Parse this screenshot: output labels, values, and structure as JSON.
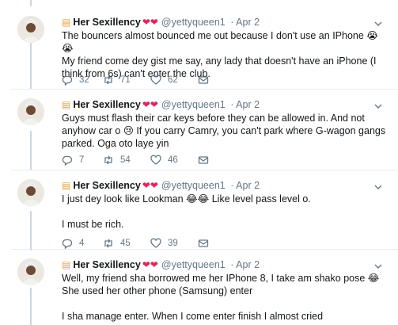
{
  "tweets": [
    {
      "author": "Her Sexillency",
      "handle": "@yettyqueen1",
      "date": "· Apr 2",
      "lines": [
        "The bouncers almost bounced me out because I don't use an IPhone 😭😭",
        "My friend come dey gist me say, any lady that doesn't have an iPhone (I think from 6s) can't enter the club."
      ],
      "replies": "32",
      "retweets": "71",
      "likes": "62"
    },
    {
      "author": "Her Sexillency",
      "handle": "@yettyqueen1",
      "date": "· Apr 2",
      "lines": [
        "Guys must flash their car keys before they can be allowed in. And not anyhow car o 😢 If you carry Camry,  you can't park where G-wagon gangs parked. Oga oto laye yin"
      ],
      "replies": "7",
      "retweets": "54",
      "likes": "46"
    },
    {
      "author": "Her Sexillency",
      "handle": "@yettyqueen1",
      "date": "· Apr 2",
      "lines": [
        "I just dey look like Lookman 😂😂 Like level pass level o.",
        "",
        "I must be rich."
      ],
      "replies": "4",
      "retweets": "45",
      "likes": "39"
    },
    {
      "author": "Her Sexillency",
      "handle": "@yettyqueen1",
      "date": "· Apr 2",
      "lines": [
        "Well, my friend sha borrowed me her IPhone 8, I take am shako pose 😂 She used her other phone (Samsung) enter",
        "",
        "I sha manage enter. When I come enter finish I almost cried"
      ]
    }
  ],
  "icons": {
    "name_prefix": "hamburger-emoji",
    "name_suffix": "hearts-emoji",
    "reply": "reply-icon",
    "retweet": "retweet-icon",
    "like": "heart-icon",
    "dm": "envelope-icon",
    "more": "chevron-down-icon"
  },
  "colors": {
    "muted": "#657786",
    "divider": "#e6ecf0",
    "thread": "#ccd6dd"
  }
}
